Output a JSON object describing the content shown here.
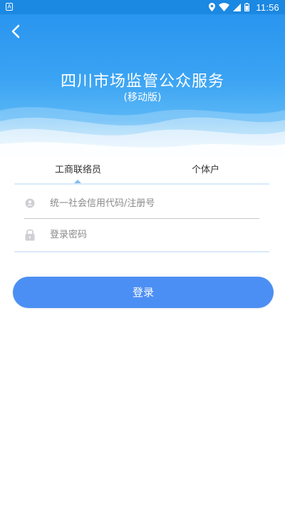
{
  "status_bar": {
    "notification_icon": "A",
    "time": "11:56",
    "icons": [
      "location-icon",
      "wifi-icon",
      "signal-icon",
      "battery-icon"
    ]
  },
  "header": {
    "title": "四川市场监管公众服务",
    "subtitle": "(移动版)",
    "back_icon": "back-arrow-icon"
  },
  "tabs": [
    {
      "label": "工商联络员",
      "selected": true
    },
    {
      "label": "个体户",
      "selected": false
    }
  ],
  "form": {
    "credit_code": {
      "placeholder": "统一社会信用代码/注册号",
      "value": "",
      "icon": "account-icon"
    },
    "password": {
      "placeholder": "登录密码",
      "value": "",
      "icon": "lock-icon"
    }
  },
  "login_button": {
    "label": "登录"
  },
  "colors": {
    "status_bar": "#1b88e2",
    "header_top": "#2a95ef",
    "accent": "#4c8ff4",
    "tab_line": "#d9eafb"
  }
}
